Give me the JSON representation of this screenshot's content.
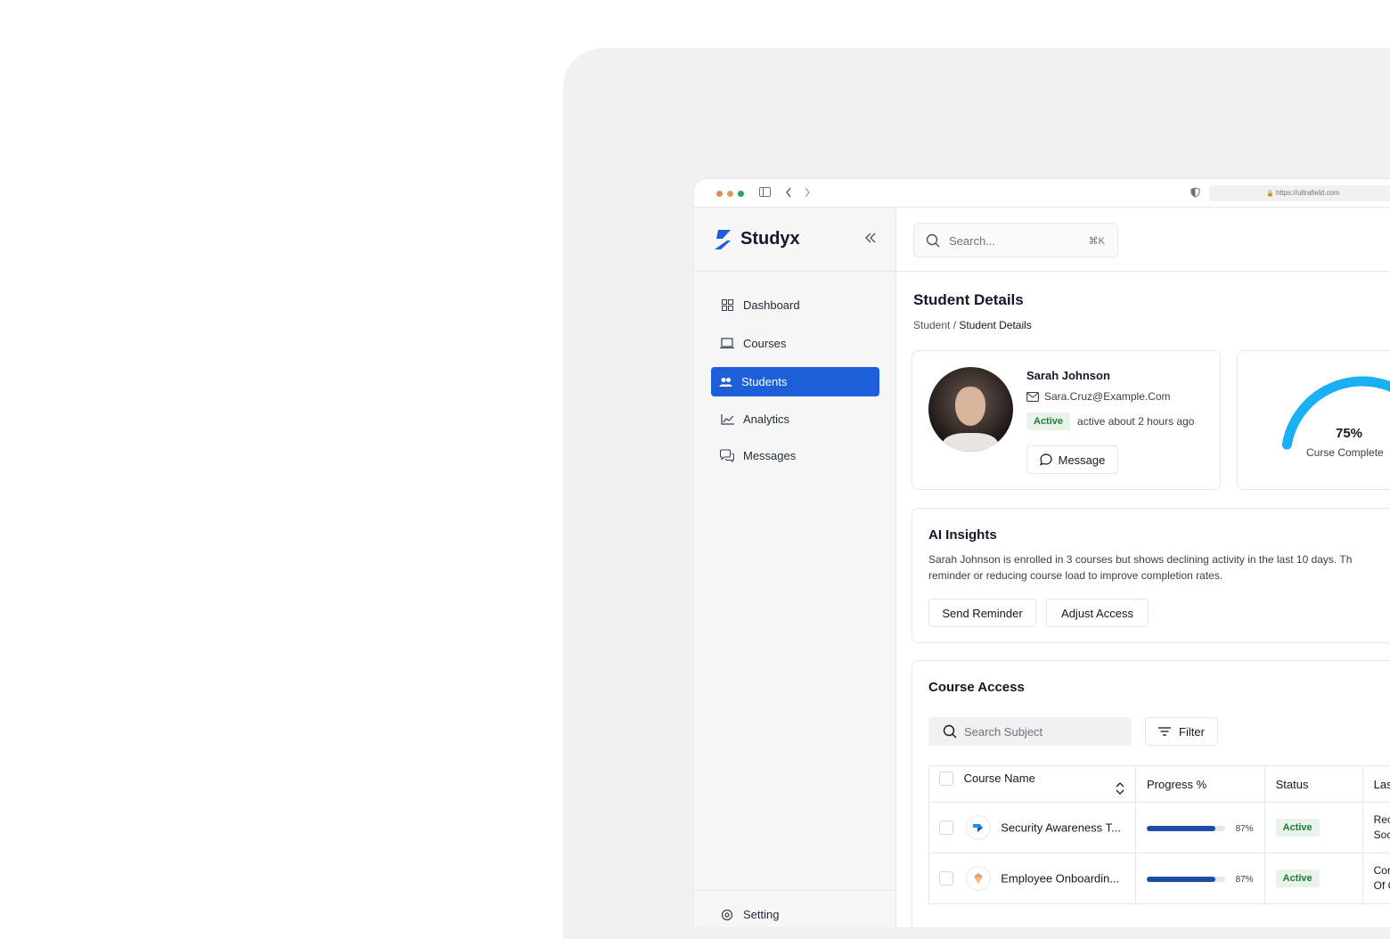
{
  "browser": {
    "url": "https://ultrafield.com",
    "dot_colors": [
      "#e0876a",
      "#d9a15a",
      "#2f9e5e"
    ]
  },
  "sidebar": {
    "brand": "Studyx",
    "brand_color": "#1c5fd9",
    "items": [
      {
        "label": "Dashboard",
        "icon": "grid-icon",
        "active": false
      },
      {
        "label": "Courses",
        "icon": "laptop-icon",
        "active": false
      },
      {
        "label": "Students",
        "icon": "users-icon",
        "active": true
      },
      {
        "label": "Analytics",
        "icon": "chart-line-icon",
        "active": false
      },
      {
        "label": "Messages",
        "icon": "chat-icon",
        "active": false
      }
    ],
    "setting_label": "Setting"
  },
  "topbar": {
    "search_placeholder": "Search...",
    "shortcut": "⌘K"
  },
  "page": {
    "title": "Student Details",
    "breadcrumb_parent": "Student",
    "breadcrumb_sep": "/",
    "breadcrumb_current": "Student Details"
  },
  "profile": {
    "name": "Sarah Johnson",
    "email": "Sara.Cruz@Example.Com",
    "status": "Active",
    "last_active": "active about 2 hours ago",
    "message_button": "Message"
  },
  "completion": {
    "value_label": "75%",
    "value": 0.75,
    "caption": "Curse Complete",
    "color": "#1ab0f5"
  },
  "insights": {
    "title": "AI Insights",
    "line1": "Sarah Johnson is enrolled in 3 courses but shows declining activity in the last 10 days. Th",
    "line2": "reminder or reducing course load to improve completion rates.",
    "send_reminder": "Send Reminder",
    "adjust_access": "Adjust Access"
  },
  "course_access": {
    "title": "Course Access",
    "search_placeholder": "Search Subject",
    "filter_label": "Filter",
    "columns": [
      "Course Name",
      "Progress %",
      "Status",
      "Las"
    ],
    "rows": [
      {
        "name": "Security Awareness T...",
        "progress": 0.87,
        "progress_label": "87%",
        "status": "Active",
        "last1": "Rec",
        "last2": "Soc",
        "icon": "security-course-icon"
      },
      {
        "name": "Employee Onboardin...",
        "progress": 0.87,
        "progress_label": "87%",
        "status": "Active",
        "last1": "Cor",
        "last2": "Of C",
        "icon": "onboarding-course-icon"
      }
    ]
  }
}
